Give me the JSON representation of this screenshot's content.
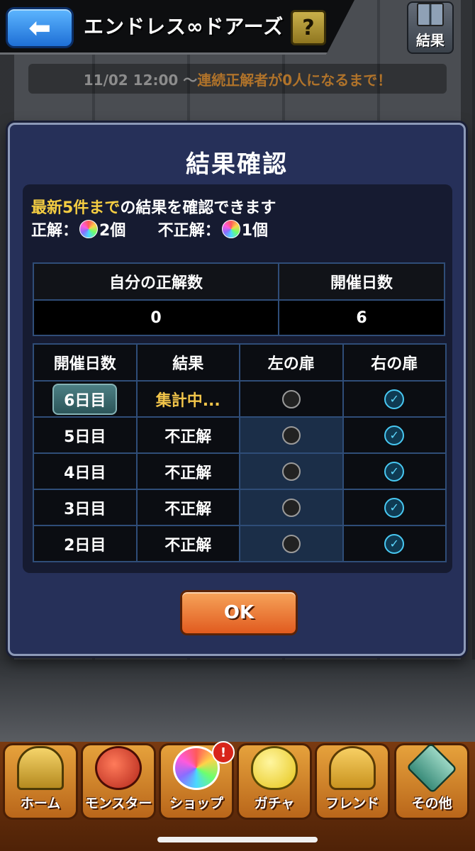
{
  "header": {
    "title": "エンドレス∞ドアーズ",
    "back_icon": "back-arrow-icon",
    "help_label": "?",
    "result_label": "結果"
  },
  "event_banner": {
    "date": "11/02 12:00 ～",
    "condition": "連続正解者が0人になるまで！"
  },
  "modal": {
    "title": "結果確認",
    "info_highlight": "最新5件まで",
    "info_text": "の結果を確認できます",
    "correct_label": "正解：",
    "correct_value": "2個",
    "incorrect_label": "不正解：",
    "incorrect_value": "1個",
    "summary": {
      "headers": [
        "自分の正解数",
        "開催日数"
      ],
      "values": [
        "0",
        "6"
      ]
    },
    "history": {
      "headers": [
        "開催日数",
        "結果",
        "左の扉",
        "右の扉"
      ],
      "rows": [
        {
          "day": "6日目",
          "result": "集計中...",
          "left": "unselected",
          "right": "selected"
        },
        {
          "day": "5日目",
          "result": "不正解",
          "left": "unselected",
          "right": "selected"
        },
        {
          "day": "4日目",
          "result": "不正解",
          "left": "unselected",
          "right": "selected"
        },
        {
          "day": "3日目",
          "result": "不正解",
          "left": "unselected",
          "right": "selected"
        },
        {
          "day": "2日目",
          "result": "不正解",
          "left": "unselected",
          "right": "selected"
        }
      ]
    },
    "ok_label": "OK"
  },
  "bottom_nav": {
    "items": [
      {
        "label": "ホーム",
        "icon": "home-icon"
      },
      {
        "label": "モンスター",
        "icon": "monster-icon"
      },
      {
        "label": "ショップ",
        "icon": "shop-icon",
        "badge": "!"
      },
      {
        "label": "ガチャ",
        "icon": "gacha-icon"
      },
      {
        "label": "フレンド",
        "icon": "friend-icon"
      },
      {
        "label": "その他",
        "icon": "other-icon"
      }
    ]
  },
  "colors": {
    "accent_yellow": "#f4cd42",
    "modal_bg": "#263059",
    "ok_orange": "#e15b1f",
    "check_cyan": "#48c8f2"
  }
}
